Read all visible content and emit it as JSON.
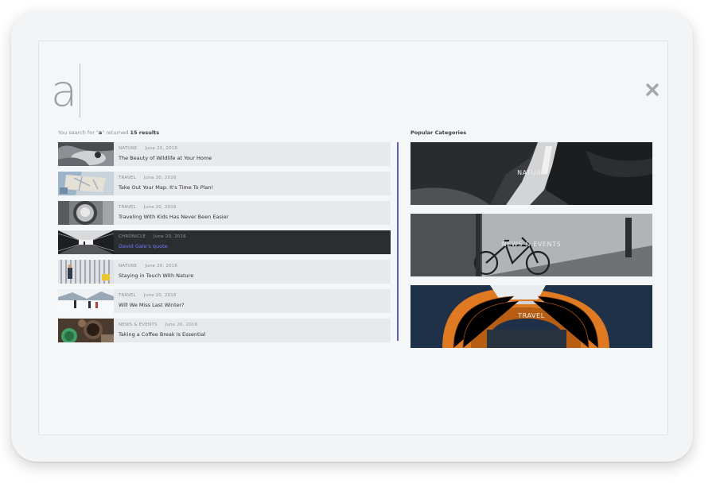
{
  "search": {
    "query": "a",
    "summary_prefix": "You search for \"",
    "summary_query": "a",
    "summary_mid": "\" returned ",
    "summary_count": "15 results"
  },
  "results": [
    {
      "category": "NATURE",
      "date": "June 20, 2016",
      "title": "The Beauty of Wildlife at Your Home"
    },
    {
      "category": "TRAVEL",
      "date": "June 20, 2016",
      "title": "Take Out Your Map. It's Time To Plan!"
    },
    {
      "category": "TRAVEL",
      "date": "June 20, 2016",
      "title": "Traveling With Kids Has Never Been Easier"
    },
    {
      "category": "CHRONICLE",
      "date": "June 20, 2016",
      "title": "David Gale's quote"
    },
    {
      "category": "NATURE",
      "date": "June 20, 2016",
      "title": "Staying in Touch With Nature"
    },
    {
      "category": "TRAVEL",
      "date": "June 20, 2016",
      "title": "Will We Miss Last Winter?"
    },
    {
      "category": "NEWS & EVENTS",
      "date": "June 20, 2016",
      "title": "Taking a Coffee Break Is Essential"
    }
  ],
  "categories": {
    "heading": "Popular Categories",
    "items": [
      {
        "label": "NATURE"
      },
      {
        "label": "NEWS & EVENTS"
      },
      {
        "label": "TRAVEL"
      }
    ]
  },
  "colors": {
    "accent": "#6f7dff",
    "active_row": "#2b2d31",
    "row_bg": "#e8e9ec",
    "scrollbar": "#5a61b5"
  },
  "icons": {
    "close": "close-icon"
  }
}
